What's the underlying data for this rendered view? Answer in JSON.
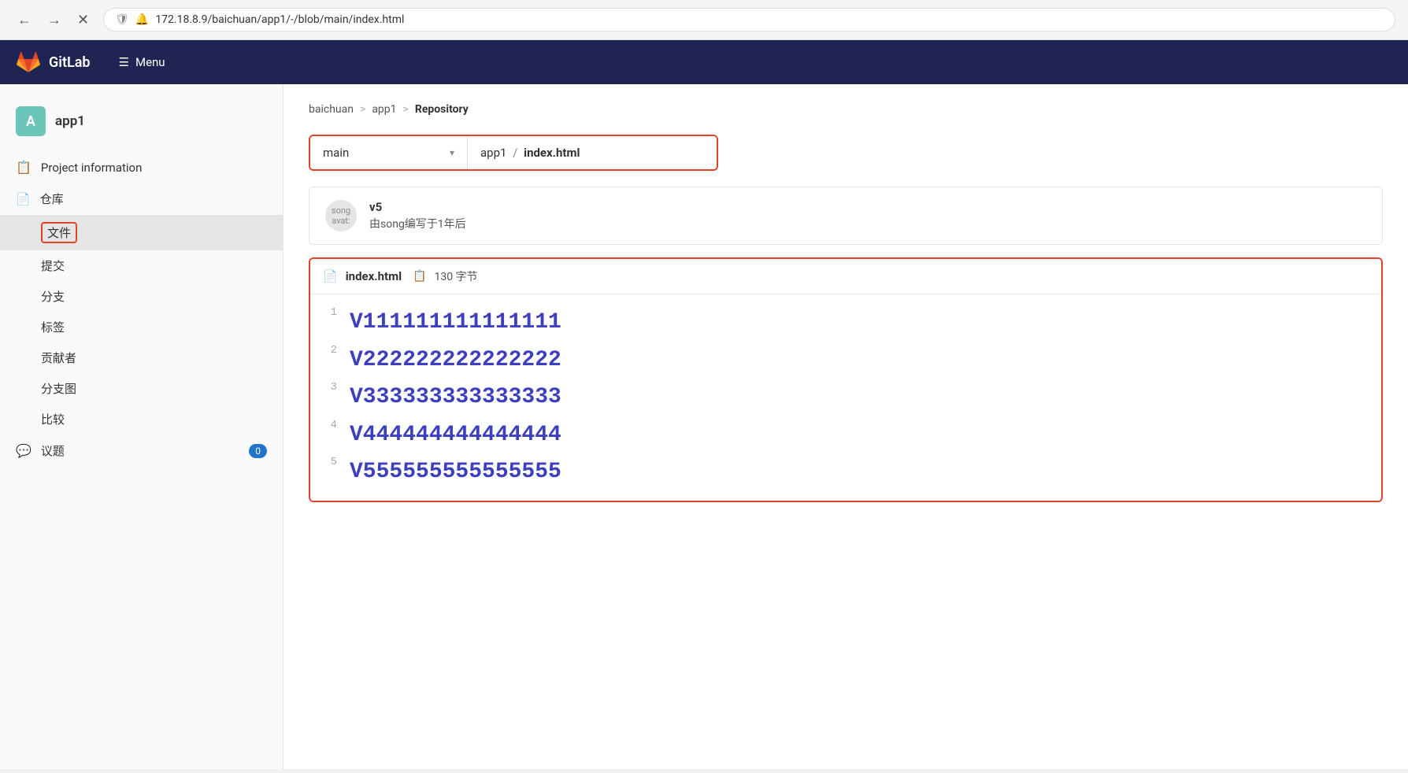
{
  "browser": {
    "back_btn": "←",
    "forward_btn": "→",
    "close_btn": "✕",
    "address": "172.18.8.9/baichuan/app1/-/blob/main/index.html",
    "security_icon": "🛡",
    "alert_icon": "🔔"
  },
  "header": {
    "title": "GitLab",
    "menu_label": "Menu"
  },
  "sidebar": {
    "project_initial": "A",
    "project_name": "app1",
    "items": [
      {
        "label": "Project information",
        "icon": "📋"
      },
      {
        "label": "仓库",
        "icon": "📄"
      },
      {
        "label": "文件",
        "active": true
      },
      {
        "label": "提交"
      },
      {
        "label": "分支"
      },
      {
        "label": "标签"
      },
      {
        "label": "贡献者"
      },
      {
        "label": "分支图"
      },
      {
        "label": "比较"
      },
      {
        "label": "议题",
        "badge": "0",
        "icon": "💬"
      }
    ]
  },
  "breadcrumb": {
    "parts": [
      "baichuan",
      "app1",
      "Repository"
    ],
    "separators": [
      ">",
      ">"
    ]
  },
  "branch_selector": {
    "branch": "main",
    "dropdown_icon": "▾",
    "path_prefix": "app1",
    "path_sep": "/",
    "file_name": "index.html"
  },
  "commit": {
    "avatar_text": "song\navat:",
    "version": "v5",
    "description": "由song编写于1年后"
  },
  "file": {
    "icon": "📄",
    "name": "index.html",
    "copy_icon": "📋",
    "size": "130 字节",
    "lines": [
      {
        "num": "1",
        "code": "<h1>V111111111111111</h1>"
      },
      {
        "num": "2",
        "code": "<h1>V222222222222222</h1>"
      },
      {
        "num": "3",
        "code": "<h1>V333333333333333</h1>"
      },
      {
        "num": "4",
        "code": "<h1>V444444444444444</h1>"
      },
      {
        "num": "5",
        "code": "<h1>V555555555555555</h1>"
      }
    ]
  }
}
